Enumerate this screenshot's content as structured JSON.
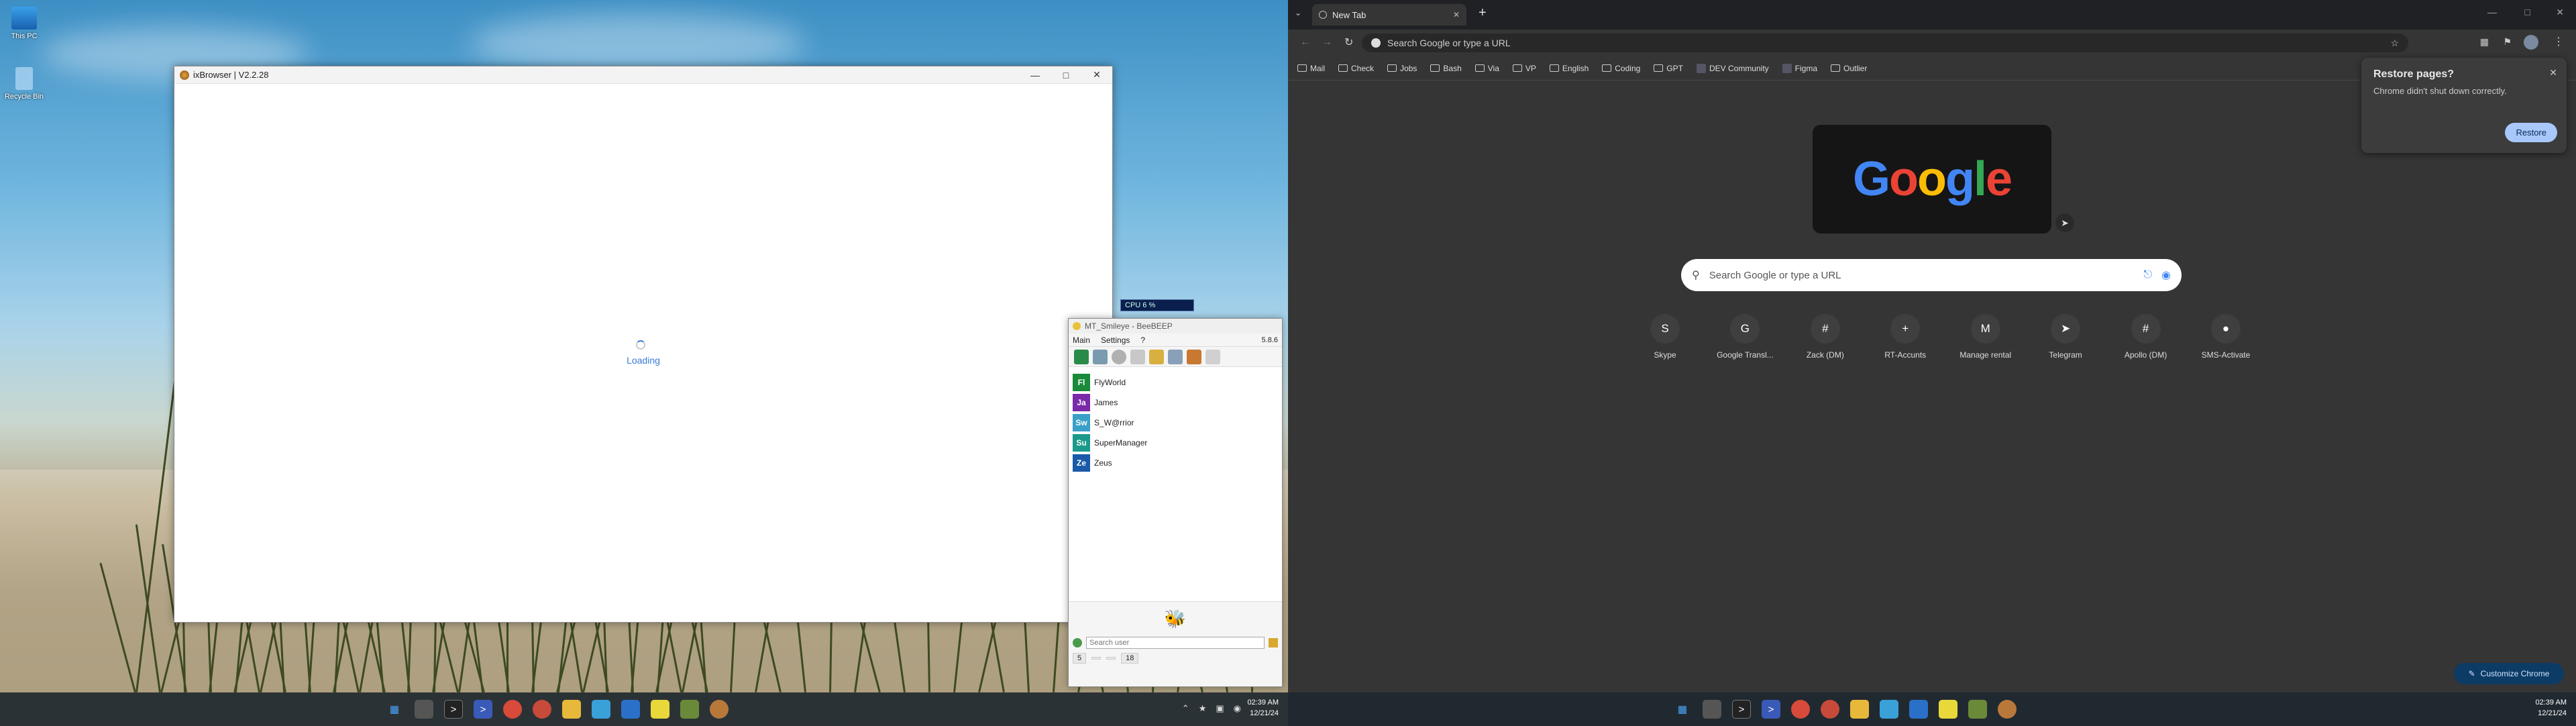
{
  "desktop": {
    "icons": [
      {
        "label": "This PC"
      },
      {
        "label": "Recycle Bin"
      }
    ]
  },
  "ixbrowser": {
    "title": "ixBrowser | V2.2.28",
    "loading_text": "Loading"
  },
  "cpu_widget": {
    "label": "CPU 6 %"
  },
  "beebeep": {
    "title": "MT_Smileye - BeeBEEP",
    "menu": [
      "Main",
      "Settings",
      "?"
    ],
    "version": "5.8.6",
    "users": [
      {
        "initials": "Fl",
        "name": "FlyWorld",
        "color": "#1a8a3a"
      },
      {
        "initials": "Ja",
        "name": "James",
        "color": "#7a2aa8"
      },
      {
        "initials": "Sw",
        "name": "S_W@rrior",
        "color": "#3aa0c8"
      },
      {
        "initials": "Su",
        "name": "SuperManager",
        "color": "#1a9a8a"
      },
      {
        "initials": "Ze",
        "name": "Zeus",
        "color": "#1a5aa8"
      }
    ],
    "search_placeholder": "Search user",
    "status": [
      "5",
      "",
      "",
      "18"
    ]
  },
  "taskbar_left": {
    "time": "02:39 AM",
    "date": "12/21/24"
  },
  "taskbar_right": {
    "time": "02:39 AM",
    "date": "12/21/24"
  },
  "chrome": {
    "tab_title": "New Tab",
    "omnibox_placeholder": "Search Google or type a URL",
    "bookmarks": [
      {
        "label": "Mail",
        "type": "folder"
      },
      {
        "label": "Check",
        "type": "folder"
      },
      {
        "label": "Jobs",
        "type": "folder"
      },
      {
        "label": "Bash",
        "type": "folder"
      },
      {
        "label": "Via",
        "type": "folder"
      },
      {
        "label": "VP",
        "type": "folder"
      },
      {
        "label": "English",
        "type": "folder"
      },
      {
        "label": "Coding",
        "type": "folder"
      },
      {
        "label": "GPT",
        "type": "folder"
      },
      {
        "label": "DEV Community",
        "type": "site"
      },
      {
        "label": "Figma",
        "type": "site"
      },
      {
        "label": "Outlier",
        "type": "folder"
      }
    ],
    "doodle_text": "Google",
    "search_placeholder": "Search Google or type a URL",
    "shortcuts": [
      {
        "label": "Skype",
        "icon": "S"
      },
      {
        "label": "Google Transl...",
        "icon": "G"
      },
      {
        "label": "Zack (DM)",
        "icon": "#"
      },
      {
        "label": "RT-Accunts",
        "icon": "+"
      },
      {
        "label": "Manage rental",
        "icon": "M"
      },
      {
        "label": "Telegram",
        "icon": "➤"
      },
      {
        "label": "Apollo (DM)",
        "icon": "#"
      },
      {
        "label": "SMS-Activate",
        "icon": "●"
      }
    ],
    "restore_dialog": {
      "title": "Restore pages?",
      "message": "Chrome didn't shut down correctly.",
      "button": "Restore"
    },
    "customize_label": "Customize Chrome"
  }
}
